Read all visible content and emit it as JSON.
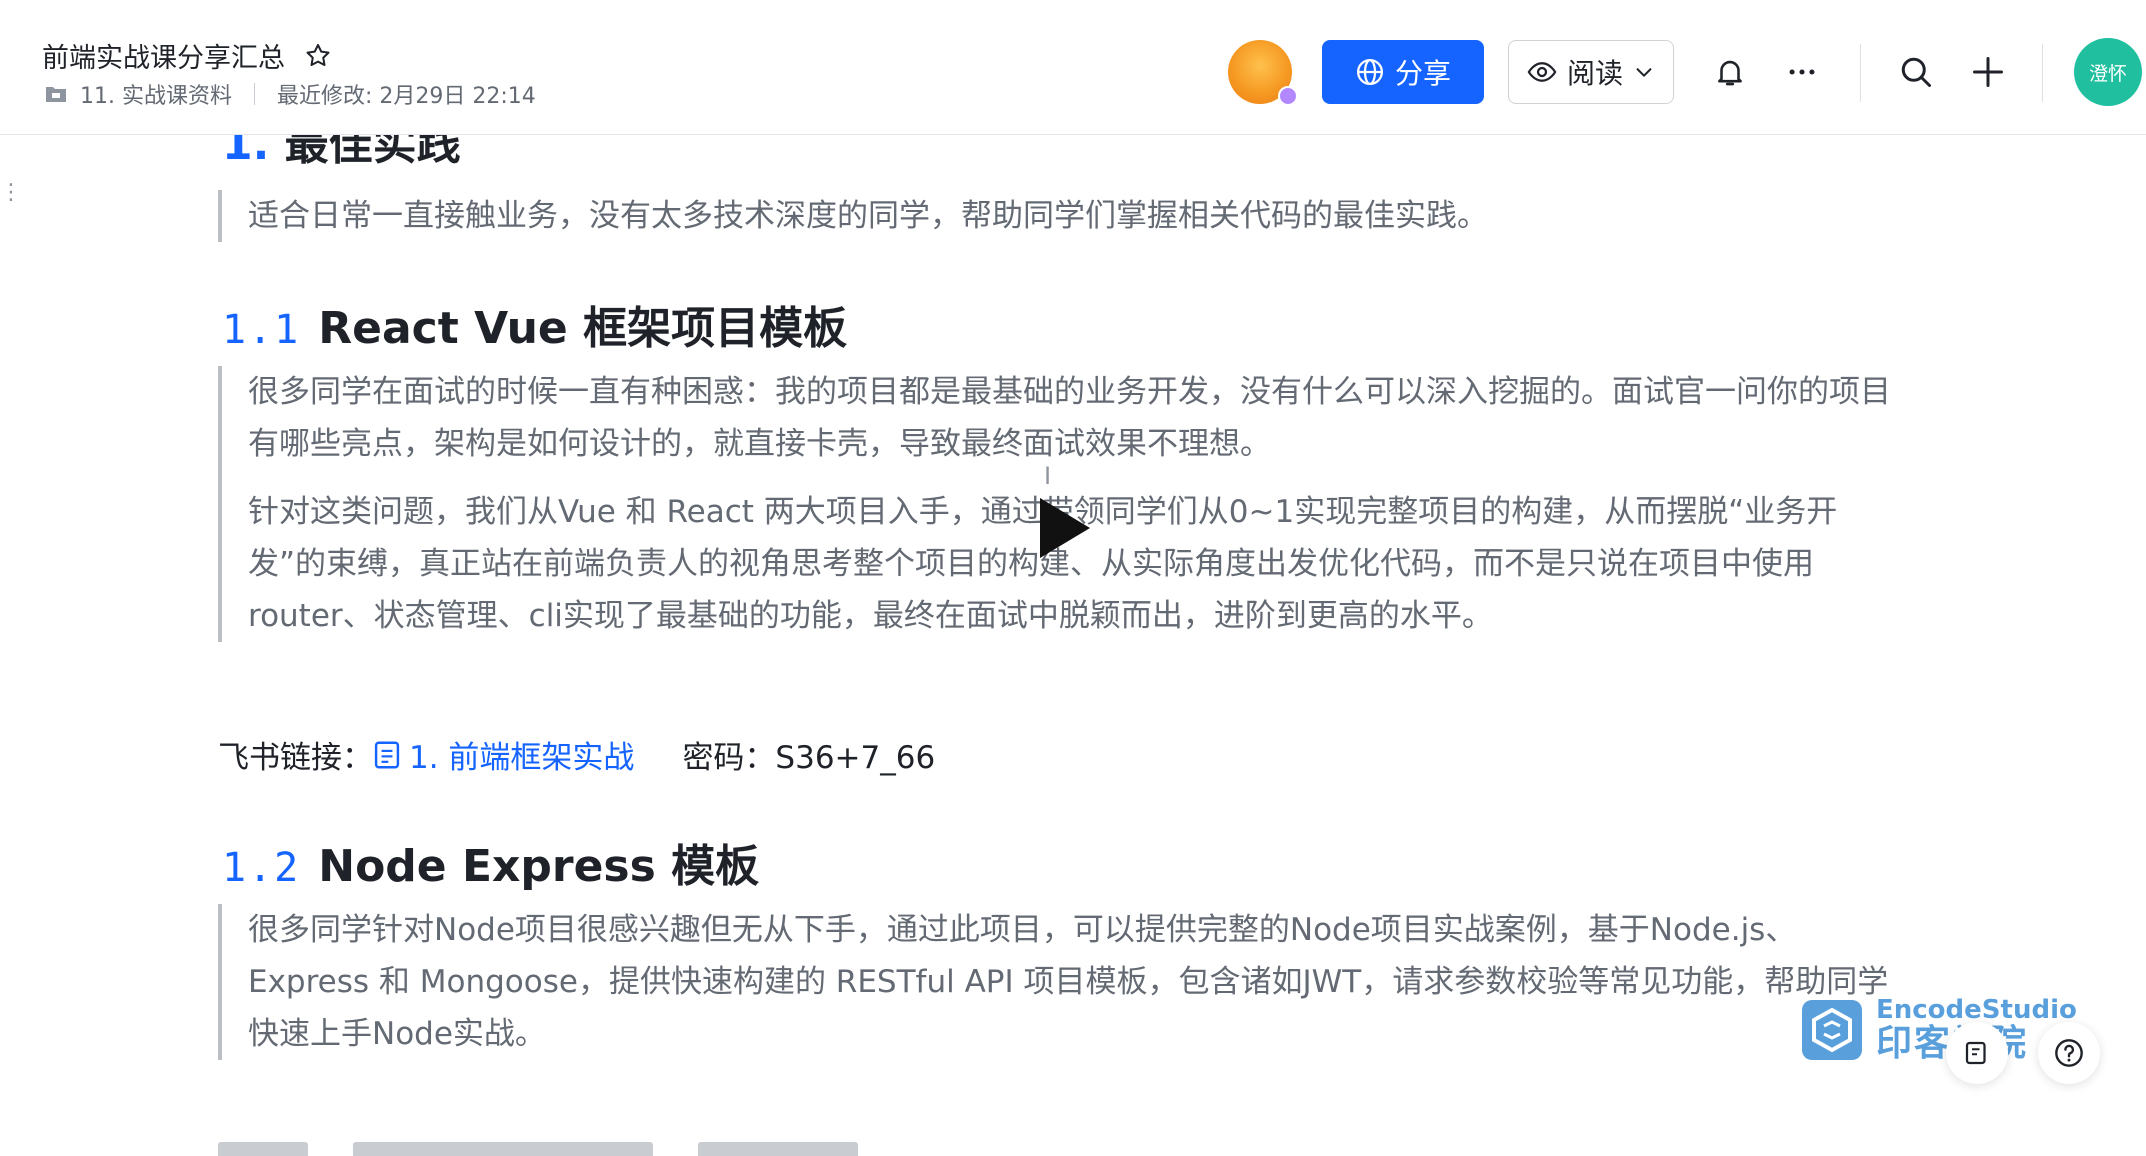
{
  "header": {
    "doc_title": "前端实战课分享汇总",
    "folder": "11. 实战课资料",
    "last_modified": "最近修改: 2月29日 22:14",
    "share_label": "分享",
    "read_label": "阅读",
    "user_avatar_text": "澄怀",
    "share_button_color": "#1664ff"
  },
  "content": {
    "top_heading": {
      "num": "1.",
      "text": "最佳实践"
    },
    "top_quote": "适合日常一直接触业务，没有太多技术深度的同学，帮助同学们掌握相关代码的最佳实践。",
    "section_1_1": {
      "num": "1.1",
      "title": "React Vue 框架项目模板",
      "p1": "很多同学在面试的时候一直有种困惑：我的项目都是最基础的业务开发，没有什么可以深入挖掘的。面试官一问你的项目有哪些亮点，架构是如何设计的，就直接卡壳，导致最终面试效果不理想。",
      "p2": "针对这类问题，我们从Vue 和 React 两大项目入手，通过带领同学们从0~1实现完整项目的构建，从而摆脱“业务开发”的束缚，真正站在前端负责人的视角思考整个项目的构建、从实际角度出发优化代码，而不是只说在项目中使用router、状态管理、cli实现了最基础的功能，最终在面试中脱颖而出，进阶到更高的水平。"
    },
    "link_row": {
      "prefix": "飞书链接：",
      "link_text": "1. 前端框架实战",
      "password": "密码：S36+7_66"
    },
    "section_1_2": {
      "num": "1.2",
      "title": "Node Express 模板",
      "p1": "很多同学针对Node项目很感兴趣但无从下手，通过此项目，可以提供完整的Node项目实战案例，基于Node.js、Express 和 Mongoose，提供快速构建的 RESTful API 项目模板，包含诸如JWT，请求参数校验等常见功能，帮助同学快速上手Node实战。"
    }
  },
  "overlay": {
    "watermark_line1": "EncodeStudio",
    "watermark_line2": "印客学院"
  },
  "icons": {
    "star": "star-icon",
    "folder": "folder-icon",
    "globe": "globe-icon",
    "eye": "eye-icon",
    "chevron": "chevron-down-icon",
    "bell": "bell-icon",
    "more": "more-icon",
    "search": "search-icon",
    "plus": "plus-icon",
    "doc": "doc-icon",
    "play": "play-icon",
    "help": "help-icon",
    "feedback": "feedback-icon"
  }
}
